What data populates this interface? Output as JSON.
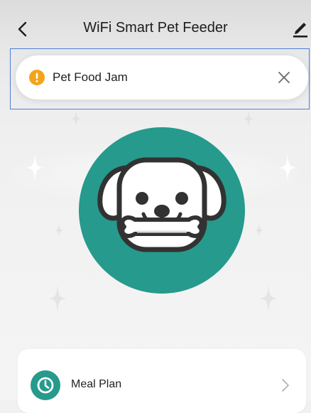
{
  "header": {
    "title": "WiFi Smart Pet Feeder",
    "back_icon": "chevron-left-icon",
    "edit_icon": "pencil-icon"
  },
  "alert": {
    "message": "Pet Food Jam",
    "icon": "warning-icon",
    "close_icon": "close-icon",
    "warning_color": "#f2a51a"
  },
  "device": {
    "avatar_icon": "dog-with-bone-icon",
    "avatar_color": "#269a8c"
  },
  "menu": {
    "items": [
      {
        "label": "Meal Plan",
        "icon": "clock-icon",
        "icon_color": "#269a8c"
      }
    ]
  }
}
